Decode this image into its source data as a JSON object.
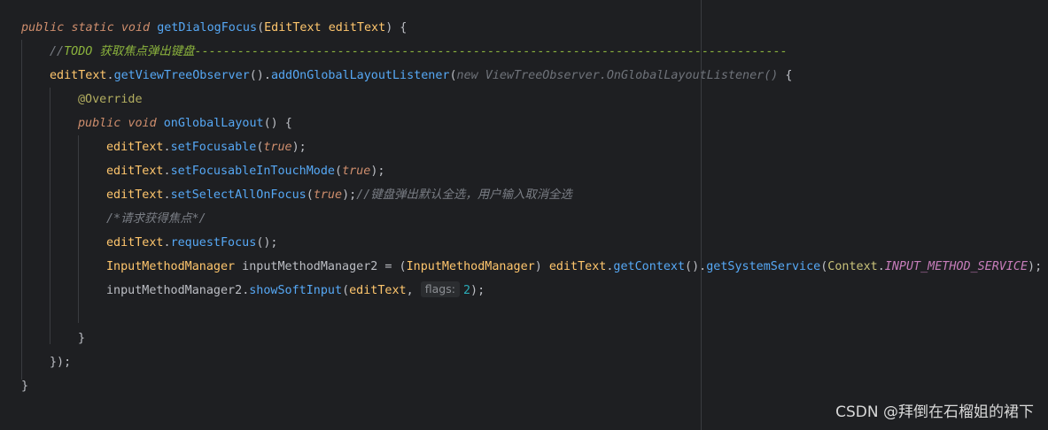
{
  "code": {
    "l1": {
      "kw1": "public",
      "kw2": "static",
      "kw3": "void",
      "method": "getDialogFocus",
      "open": "(",
      "type": "EditText",
      "space": " ",
      "param": "editText",
      "close": ") {"
    },
    "l2": {
      "comment_prefix": "//",
      "todo": "TODO 获取焦点弹出键盘-----------------------------------------------------------------------------------"
    },
    "l3": {
      "var": "editText",
      "dot1": ".",
      "m1": "getViewTreeObserver",
      "p1": "().",
      "m2": "addOnGlobalLayoutListener",
      "p2": "(",
      "hint": "new ViewTreeObserver.OnGlobalLayoutListener()",
      "p3": " {"
    },
    "l4": {
      "anno": "@Override"
    },
    "l5": {
      "kw1": "public",
      "kw2": "void",
      "method": "onGlobalLayout",
      "rest": "() {"
    },
    "l6": {
      "var": "editText",
      "dot": ".",
      "method": "setFocusable",
      "open": "(",
      "val": "true",
      "close": ");"
    },
    "l7": {
      "var": "editText",
      "dot": ".",
      "method": "setFocusableInTouchMode",
      "open": "(",
      "val": "true",
      "close": ");"
    },
    "l8": {
      "var": "editText",
      "dot": ".",
      "method": "setSelectAllOnFocus",
      "open": "(",
      "val": "true",
      "close": ");",
      "comment": "//键盘弹出默认全选，用户输入取消全选"
    },
    "l9": {
      "comment": "/*请求获得焦点*/"
    },
    "l10": {
      "var": "editText",
      "dot": ".",
      "method": "requestFocus",
      "rest": "();"
    },
    "l11": {
      "type": "InputMethodManager",
      "name": " inputMethodManager2 = (",
      "cast": "InputMethodManager",
      "c2": ") ",
      "var": "editText",
      "dot": ".",
      "m1": "getContext",
      "p1": "().",
      "m2": "getSystemService",
      "p2": "(",
      "ctx": "Context",
      "dot2": ".",
      "const": "INPUT_METHOD_SERVICE",
      "end": ");"
    },
    "l12": {
      "name": "inputMethodManager2",
      "dot": ".",
      "method": "showSoftInput",
      "open": "(",
      "var": "editText",
      "comma": ", ",
      "hint": "flags:",
      "num": "2",
      "close": ");"
    },
    "l14": {
      "text": "}"
    },
    "l15": {
      "text": "});"
    },
    "l16": {
      "text": "}"
    }
  },
  "watermark": "CSDN @拜倒在石榴姐的裙下",
  "colors": {
    "background": "#1e1f22",
    "keyword": "#cf8e6d",
    "method": "#56a8f5",
    "field": "#ffc66d",
    "comment": "#7a7e85",
    "todo": "#8bb33d"
  }
}
